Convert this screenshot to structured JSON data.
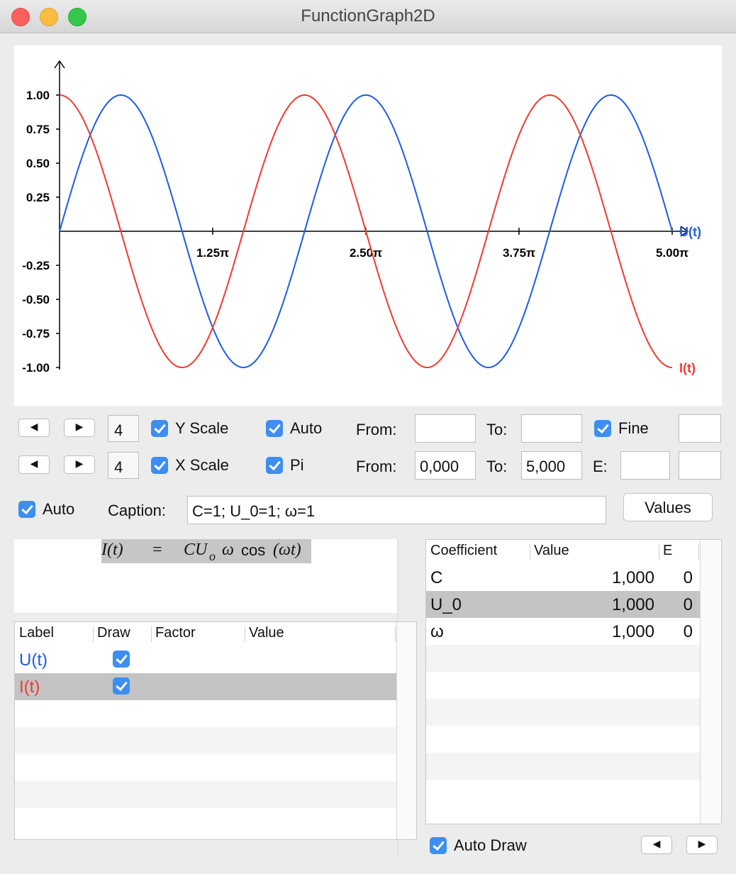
{
  "window": {
    "title": "FunctionGraph2D"
  },
  "chart_data": {
    "type": "line",
    "xlim": [
      0,
      5
    ],
    "x_unit": "π",
    "ylim": [
      -1,
      1
    ],
    "x_ticks": [
      "1.25π",
      "2.50π",
      "3.75π",
      "5.00π"
    ],
    "y_ticks": [
      "1.00",
      "0.75",
      "0.50",
      "0.25",
      "-0.25",
      "-0.50",
      "-0.75",
      "-1.00"
    ],
    "series": [
      {
        "name": "U(t)",
        "function": "sin(t)",
        "color": "#1f5be8",
        "x": [
          0,
          0.5,
          1,
          1.5,
          2,
          2.5,
          3,
          3.5,
          4,
          4.5,
          5
        ],
        "values": [
          0,
          1,
          0,
          -1,
          0,
          1,
          0,
          -1,
          0,
          1,
          0
        ]
      },
      {
        "name": "I(t)",
        "function": "cos(t)",
        "color": "#f23a2e",
        "x": [
          0,
          0.5,
          1,
          1.5,
          2,
          2.5,
          3,
          3.5,
          4,
          4.5,
          5
        ],
        "values": [
          1,
          0,
          -1,
          0,
          1,
          0,
          -1,
          0,
          1,
          0,
          -1
        ]
      }
    ],
    "grid": false
  },
  "controls": {
    "y_row": {
      "prev_icon": "triangle-left-icon",
      "next_icon": "triangle-right-icon",
      "count": "4",
      "scale_label": "Y Scale",
      "scale_checked": true,
      "auto_label": "Auto",
      "auto_checked": true,
      "from_label": "From:",
      "from_value": "",
      "to_label": "To:",
      "to_value": "",
      "fine_label": "Fine",
      "fine_checked": true,
      "fine_value": ""
    },
    "x_row": {
      "prev_icon": "triangle-left-icon",
      "next_icon": "triangle-right-icon",
      "count": "4",
      "scale_label": "X Scale",
      "scale_checked": true,
      "pi_label": "Pi",
      "pi_checked": true,
      "from_label": "From:",
      "from_value": "0,000",
      "to_label": "To:",
      "to_value": "5,000",
      "e_label": "E:",
      "e_value": "",
      "extra_value": ""
    },
    "caption_row": {
      "auto_label": "Auto",
      "auto_checked": true,
      "caption_label": "Caption:",
      "caption_value": "C=1; U_0=1; ω=1",
      "values_button": "Values"
    }
  },
  "formula": {
    "lhs": "I(t)",
    "eq": "=",
    "rhs_italic": "CU",
    "rhs_sub": "o",
    "rhs_omega": "ω",
    "rhs_fn": "cos",
    "rhs_arg": "(ωt)"
  },
  "function_table": {
    "columns": [
      "Label",
      "Draw",
      "Factor",
      "Value"
    ],
    "rows": [
      {
        "label": "U(t)",
        "draw": true,
        "factor": "",
        "value": "",
        "color": "#1f5be8",
        "selected": false
      },
      {
        "label": "I(t)",
        "draw": true,
        "factor": "",
        "value": "",
        "color": "#f23a2e",
        "selected": true
      }
    ]
  },
  "coefficient_table": {
    "columns": [
      "Coefficient",
      "Value",
      "E"
    ],
    "rows": [
      {
        "name": "C",
        "value": "1,000",
        "e": "0",
        "selected": false
      },
      {
        "name": "U_0",
        "value": "1,000",
        "e": "0",
        "selected": true
      },
      {
        "name": "ω",
        "value": "1,000",
        "e": "0",
        "selected": false
      }
    ]
  },
  "footer": {
    "auto_draw_label": "Auto Draw",
    "auto_draw_checked": true,
    "prev_icon": "triangle-left-icon",
    "next_icon": "triangle-right-icon"
  }
}
